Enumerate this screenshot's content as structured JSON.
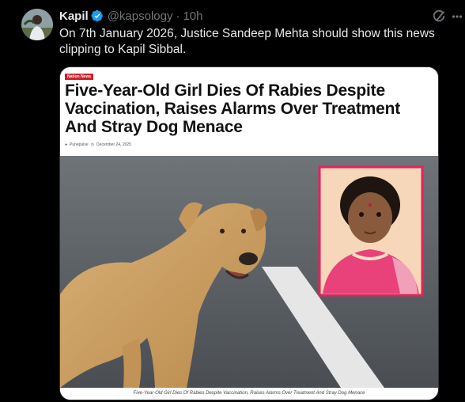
{
  "tweet": {
    "author_name": "Kapil",
    "handle": "@kapsology",
    "separator": "·",
    "time": "10h",
    "text": "On 7th January 2026, Justice Sandeep Mehta should show this news clipping to Kapil Sibbal."
  },
  "clipping": {
    "category_tag": "Nation News",
    "headline": "Five-Year-Old Girl Dies Of Rabies Despite Vaccination, Raises Alarms Over Treatment And Stray Dog Menace",
    "author": "Punepulse",
    "date": "December 24, 2025",
    "caption": "Five-Year-Old Girl Dies Of Rabies Despite Vaccination, Raises Alarms Over Treatment And Stray Dog Menace"
  },
  "colors": {
    "background": "#000000",
    "verified_badge": "#1d9bf0",
    "tag_red": "#d3202a",
    "inset_border": "#e0245e"
  },
  "icons": [
    "verified-badge-icon",
    "grok-icon",
    "more-options-icon",
    "user-icon",
    "clock-icon"
  ]
}
